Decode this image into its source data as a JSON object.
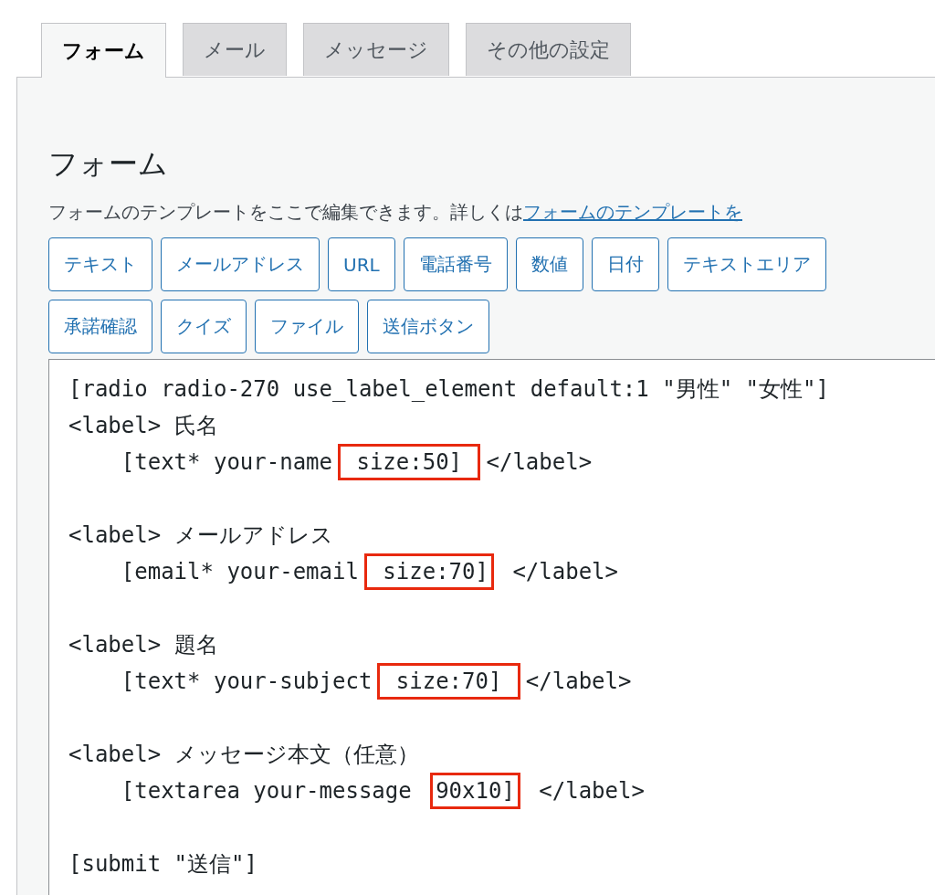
{
  "tabs": [
    {
      "label": "フォーム",
      "selected": true
    },
    {
      "label": "メール",
      "selected": false
    },
    {
      "label": "メッセージ",
      "selected": false
    },
    {
      "label": "その他の設定",
      "selected": false
    }
  ],
  "panel": {
    "heading": "フォーム",
    "description": "フォームのテンプレートをここで編集できます。詳しくは",
    "description_link": "フォームのテンプレートを"
  },
  "tag_buttons": [
    [
      "テキスト",
      "メールアドレス",
      "URL",
      "電話番号",
      "数値",
      "日付",
      "テキストエリア"
    ],
    [
      "承諾確認",
      "クイズ",
      "ファイル",
      "送信ボタン"
    ]
  ],
  "editor": {
    "blocks": [
      {
        "lines": [
          [
            {
              "text": "[radio radio-270 use_label_element default:1 \"男性\" \"女性\"]",
              "highlighted": false
            }
          ],
          [
            {
              "text": "<label> 氏名",
              "highlighted": false
            }
          ],
          [
            {
              "text": "    [text* your-name",
              "highlighted": false
            },
            {
              "text": " size:50] ",
              "highlighted": true
            },
            {
              "text": "</label>",
              "highlighted": false
            }
          ]
        ]
      },
      {
        "lines": [
          [
            {
              "text": "<label> メールアドレス",
              "highlighted": false
            }
          ],
          [
            {
              "text": "    [email* your-email",
              "highlighted": false
            },
            {
              "text": " size:70]",
              "highlighted": true
            },
            {
              "text": " </label>",
              "highlighted": false
            }
          ]
        ]
      },
      {
        "lines": [
          [
            {
              "text": "<label> 題名",
              "highlighted": false
            }
          ],
          [
            {
              "text": "    [text* your-subject",
              "highlighted": false
            },
            {
              "text": " size:70] ",
              "highlighted": true
            },
            {
              "text": "</label>",
              "highlighted": false
            }
          ]
        ]
      },
      {
        "lines": [
          [
            {
              "text": "<label> メッセージ本文（任意）",
              "highlighted": false
            }
          ],
          [
            {
              "text": "    [textarea your-message ",
              "highlighted": false
            },
            {
              "text": "90x10]",
              "highlighted": true
            },
            {
              "text": " </label>",
              "highlighted": false
            }
          ]
        ]
      },
      {
        "lines": [
          [
            {
              "text": "[submit \"送信\"]",
              "highlighted": false
            }
          ]
        ]
      }
    ]
  }
}
